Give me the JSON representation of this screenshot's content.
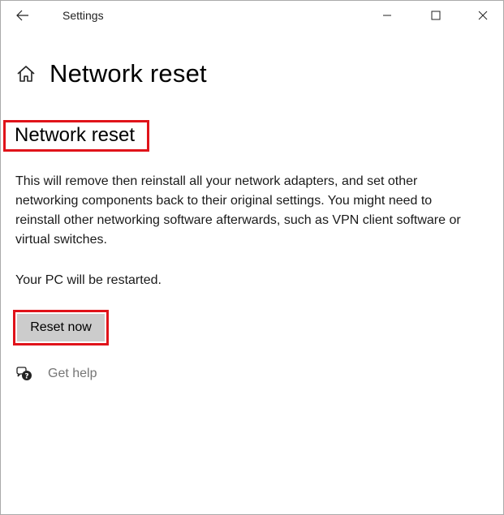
{
  "titlebar": {
    "back_icon": "back-arrow-icon",
    "title": "Settings",
    "minimize_icon": "minimize-icon",
    "maximize_icon": "maximize-icon",
    "close_icon": "close-icon"
  },
  "header": {
    "home_icon": "home-icon",
    "title": "Network reset"
  },
  "section": {
    "title": "Network reset",
    "description": "This will remove then reinstall all your network adapters, and set other networking components back to their original settings. You might need to reinstall other networking software afterwards, such as VPN client software or virtual switches.",
    "restart_note": "Your PC will be restarted.",
    "reset_button_label": "Reset now",
    "help_icon": "help-chat-icon",
    "help_label": "Get help"
  },
  "colors": {
    "highlight": "#e0131a",
    "button_bg": "#cccccc",
    "help_text": "#767676"
  }
}
